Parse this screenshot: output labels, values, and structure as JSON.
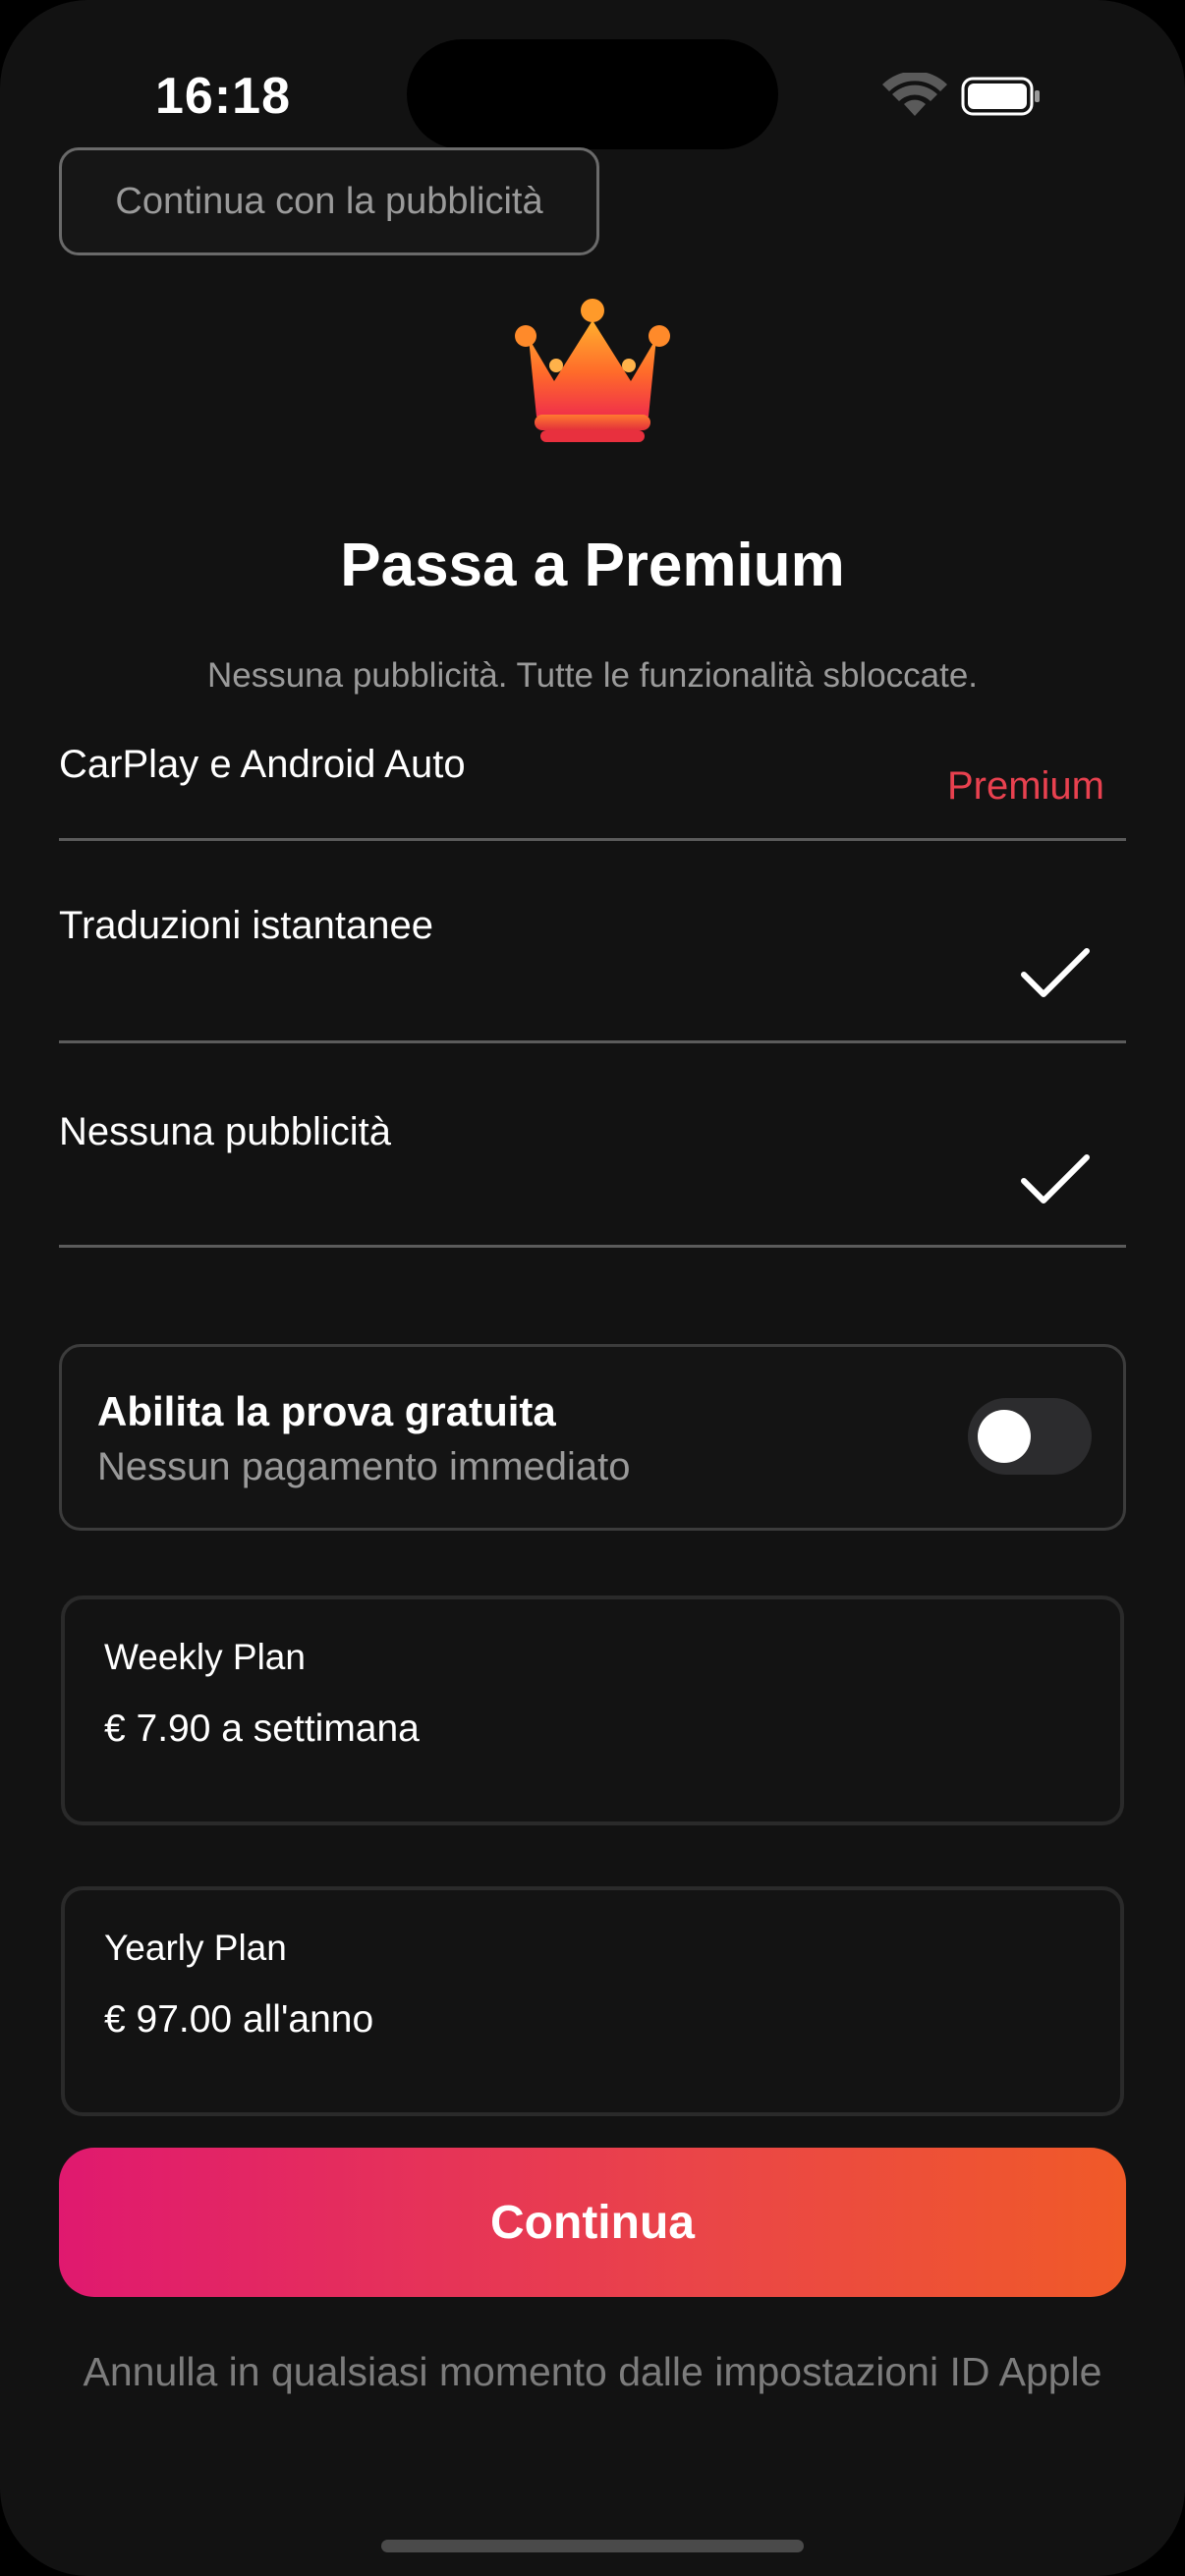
{
  "status_bar": {
    "time": "16:18",
    "icons": [
      "wifi-icon",
      "battery-icon"
    ]
  },
  "ads_button": {
    "label": "Continua con la pubblicità"
  },
  "hero": {
    "icon": "crown-icon",
    "title": "Passa a Premium",
    "subtitle": "Nessuna pubblicità. Tutte le funzionalità sbloccate."
  },
  "features": [
    {
      "label": "CarPlay e Android Auto",
      "value": "Premium"
    },
    {
      "label": "Traduzioni istantanee",
      "value_icon": "checkmark-icon"
    },
    {
      "label": "Nessuna pubblicità",
      "value_icon": "checkmark-icon"
    }
  ],
  "trial": {
    "title": "Abilita la prova gratuita",
    "subtitle": "Nessun pagamento immediato",
    "toggle_on": false
  },
  "plans": [
    {
      "name": "Weekly Plan",
      "price": "€ 7.90 a settimana"
    },
    {
      "name": "Yearly Plan",
      "price": "€ 97.00 all'anno"
    }
  ],
  "continue_button": {
    "label": "Continua"
  },
  "footer": {
    "text": "Annulla in qualsiasi momento dalle impostazioni ID Apple"
  },
  "colors": {
    "background": "#121212",
    "accent_premium": "#e8414f",
    "gradient_start": "#e0196f",
    "gradient_end": "#f05a28"
  }
}
